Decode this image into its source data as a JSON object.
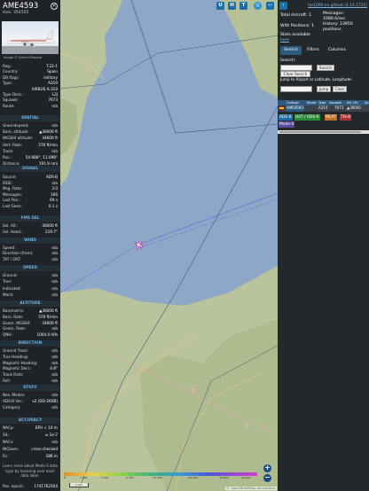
{
  "aircraft": {
    "registration": "AME4593",
    "hex_label": "Hex:",
    "hex": "354555",
    "image_credit": "Image © Ammit Basave"
  },
  "details": [
    {
      "k": "Reg.:",
      "v": "T.22-1"
    },
    {
      "k": "Country:",
      "v": "Spain"
    },
    {
      "k": "DB flags:",
      "v": "military"
    },
    {
      "k": "Type:",
      "v": "A310"
    },
    {
      "k": "",
      "v": "AIRBUS A-310"
    },
    {
      "k": "Type Desc.:",
      "v": "L2J"
    },
    {
      "k": "Squawk:",
      "v": "7673"
    },
    {
      "k": "Route:",
      "v": "n/a"
    }
  ],
  "sections": {
    "spatial": "SPATIAL",
    "signal": "SIGNAL",
    "fms": "FMS SEL",
    "wind": "WIND",
    "speed": "SPEED",
    "altitude": "ALTITUDE",
    "direction": "DIRECTION",
    "stuff": "STUFF",
    "accuracy": "ACCURACY"
  },
  "spatial": [
    {
      "k": "Groundspeed:",
      "v": "n/a"
    },
    {
      "k": "Baro. altitude:",
      "v": "▲36000 ft"
    },
    {
      "k": "WGS84 altitude:",
      "v": "34600 ft"
    },
    {
      "k": "Vert. Rate:",
      "v": "576 ft/min"
    },
    {
      "k": "Track:",
      "v": "n/a"
    },
    {
      "k": "Pos.:",
      "v": "54.088°, 11.098°"
    },
    {
      "k": "Distance:",
      "v": "191.9 nmi"
    }
  ],
  "signal": [
    {
      "k": "Source:",
      "v": "ADS-B"
    },
    {
      "k": "RSSI:",
      "v": "n/a"
    },
    {
      "k": "Msg. Rate:",
      "v": "3.0"
    },
    {
      "k": "Messages:",
      "v": "166"
    },
    {
      "k": "Last Pos.:",
      "v": "69 s"
    },
    {
      "k": "Last Seen:",
      "v": "0.1 s"
    }
  ],
  "fms": [
    {
      "k": "Sel. Alt.:",
      "v": "36000 ft"
    },
    {
      "k": "Sel. Head.:",
      "v": "219.7°"
    }
  ],
  "wind": [
    {
      "k": "Speed:",
      "v": "n/a"
    },
    {
      "k": "Direction (from):",
      "v": "n/a"
    },
    {
      "k": "TAT / OAT:",
      "v": "n/a"
    }
  ],
  "speed": [
    {
      "k": "Ground:",
      "v": "n/a"
    },
    {
      "k": "True:",
      "v": "n/a"
    },
    {
      "k": "Indicated:",
      "v": "n/a"
    },
    {
      "k": "Mach:",
      "v": "n/a"
    }
  ],
  "altitude": [
    {
      "k": "Barometric:",
      "v": "▲36000 ft"
    },
    {
      "k": "Baro. Rate:",
      "v": "576 ft/min"
    },
    {
      "k": "Geom. WGS84:",
      "v": "34600 ft"
    },
    {
      "k": "Geom. Rate:",
      "v": "n/a"
    },
    {
      "k": "QNH:",
      "v": "1004.0 hPa"
    }
  ],
  "direction": [
    {
      "k": "Ground Track:",
      "v": "n/a"
    },
    {
      "k": "True Heading:",
      "v": "n/a"
    },
    {
      "k": "Magnetic Heading:",
      "v": "n/a"
    },
    {
      "k": "Magnetic Decl.:",
      "v": "4.8°"
    },
    {
      "k": "Track Rate:",
      "v": "n/a"
    },
    {
      "k": "Roll:",
      "v": "n/a"
    }
  ],
  "stuff": [
    {
      "k": "Nav. Modes:",
      "v": "n/a"
    },
    {
      "k": "ADS-B Ver.:",
      "v": "v2 (DO-260B)"
    },
    {
      "k": "Category:",
      "v": "n/a"
    }
  ],
  "accuracy": [
    {
      "k": "NACp:",
      "v": "EPU < 10 m"
    },
    {
      "k": "SIL:",
      "v": "≤ 1e-7"
    },
    {
      "k": "NACv:",
      "v": "n/a"
    },
    {
      "k": "NICbaro:",
      "v": "cross-checked"
    },
    {
      "k": "Rc:",
      "v": "186 m"
    }
  ],
  "learn_more": "Learn more about Mode S data type by hovering over each data label.",
  "pos_epoch": {
    "k": "Pos. epoch:",
    "v": "1741762504"
  },
  "map_buttons": [
    "U",
    "H",
    "T"
  ],
  "map_side_buttons": [
    "◯",
    "L",
    "O",
    "K",
    "M",
    "P",
    "I",
    "R",
    "F"
  ],
  "altitude_legend": [
    "2 000",
    "4 000",
    "6 000",
    "10 000",
    "20 000",
    "30 000",
    "40 000"
  ],
  "altitude_legend_unit": "ft",
  "scale_label": "5 km",
  "osm_credit": "© OpenStreetMap contributors",
  "right": {
    "version_link": "tar1090 on github (3.14.1722)",
    "total_aircraft_label": "Total Aircraft: 1",
    "messages_label": "Messages:",
    "messages_value": "1080.6/sec",
    "with_positions_label": "With Positions: 1",
    "history_label": "History: 23950",
    "history_value": "positions",
    "stats_label": "Stats available",
    "stats_link": "here",
    "tabs": [
      "Search",
      "Filters",
      "Columns"
    ],
    "search_label": "Search:",
    "search_button": "Search",
    "clear_search_button": "Clear Search",
    "jump_label": "Jump to Airport or Latitude, Longitude:",
    "jump_button": "Jump",
    "clear_button": "Clear",
    "columns": [
      "Callsign",
      "Route",
      "Type",
      "Squawk",
      "Alt. (ft)",
      "Sp"
    ],
    "row": {
      "callsign": "AME4593",
      "type": "A310",
      "squawk": "7673",
      "alt": "▲36000"
    },
    "legend": [
      "ADS-B",
      "UAT / ADS-R",
      "MLAT",
      "TIS-B"
    ],
    "legend_mode_s": "Mode-S"
  },
  "colors": {
    "accent": "#1c6ea4",
    "land": "#b8c09a",
    "water": "#8ea7c6",
    "track": "#5a5ad6"
  }
}
